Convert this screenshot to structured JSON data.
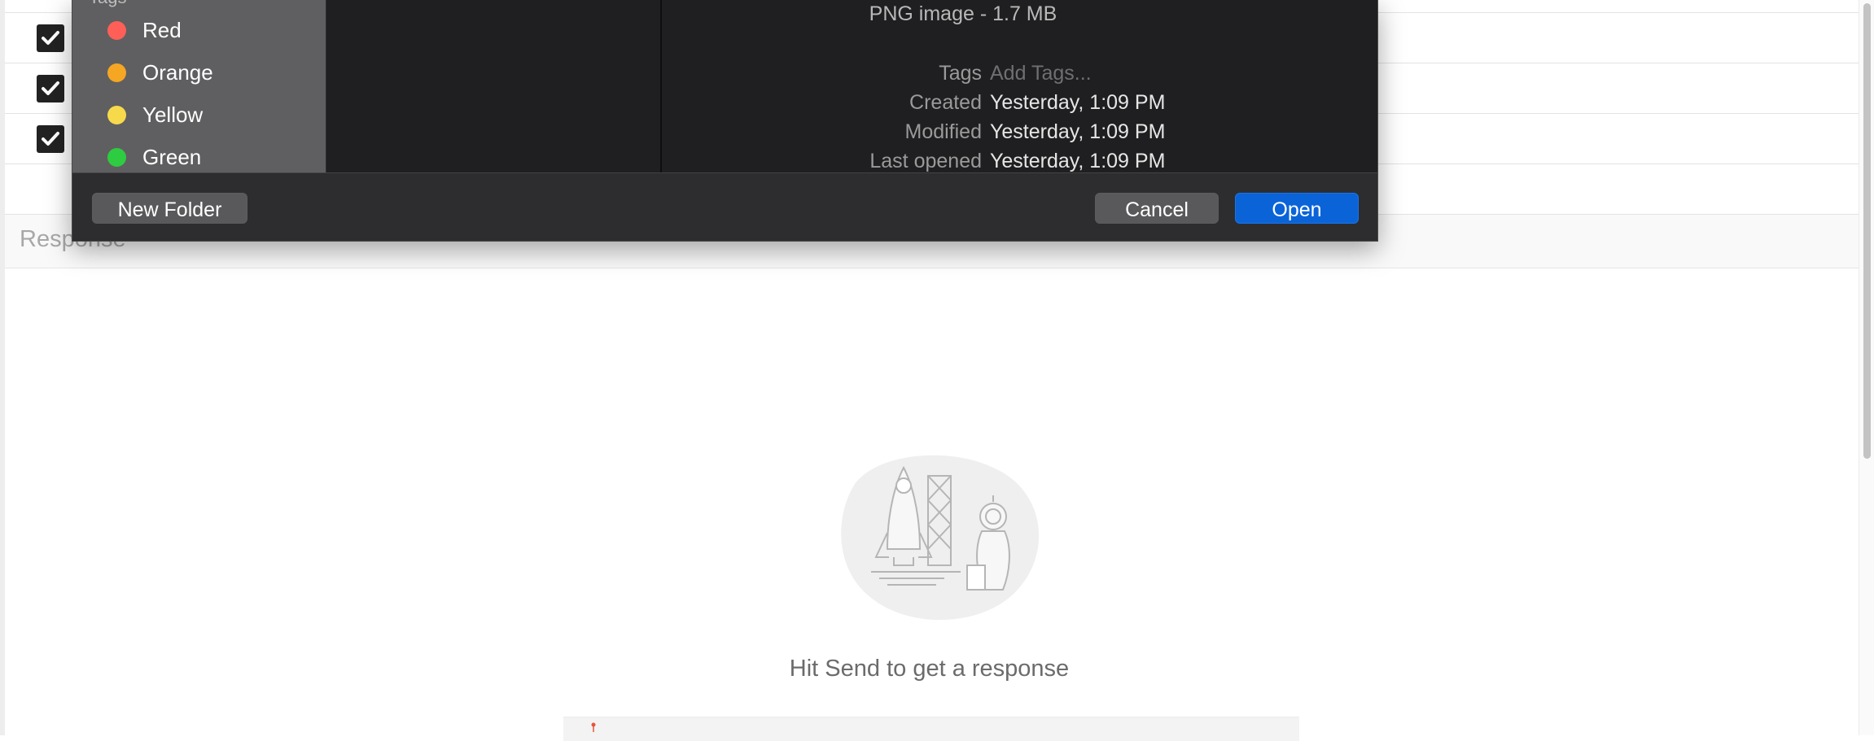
{
  "background": {
    "response_label": "Response",
    "empty_state_text": "Hit Send to get a response",
    "illustration_icon": "rocket-launch-astronaut-illustration"
  },
  "open_dialog": {
    "sidebar": {
      "section_header": "Tags",
      "tags": [
        {
          "label": "Red",
          "color": "#ff5f57"
        },
        {
          "label": "Orange",
          "color": "#f5a623"
        },
        {
          "label": "Yellow",
          "color": "#f7d94c"
        },
        {
          "label": "Green",
          "color": "#2ecc40"
        }
      ]
    },
    "preview": {
      "file_kind": "PNG image - 1.7 MB",
      "info": [
        {
          "key": "Tags",
          "value": "Add Tags..."
        },
        {
          "key": "Created",
          "value": "Yesterday, 1:09 PM"
        },
        {
          "key": "Modified",
          "value": "Yesterday, 1:09 PM"
        },
        {
          "key": "Last opened",
          "value": "Yesterday, 1:09 PM"
        }
      ]
    },
    "footer": {
      "new_folder_label": "New Folder",
      "cancel_label": "Cancel",
      "open_label": "Open"
    }
  },
  "colors": {
    "open_button": "#0a64d8",
    "dialog_background": "#1e1e20"
  }
}
